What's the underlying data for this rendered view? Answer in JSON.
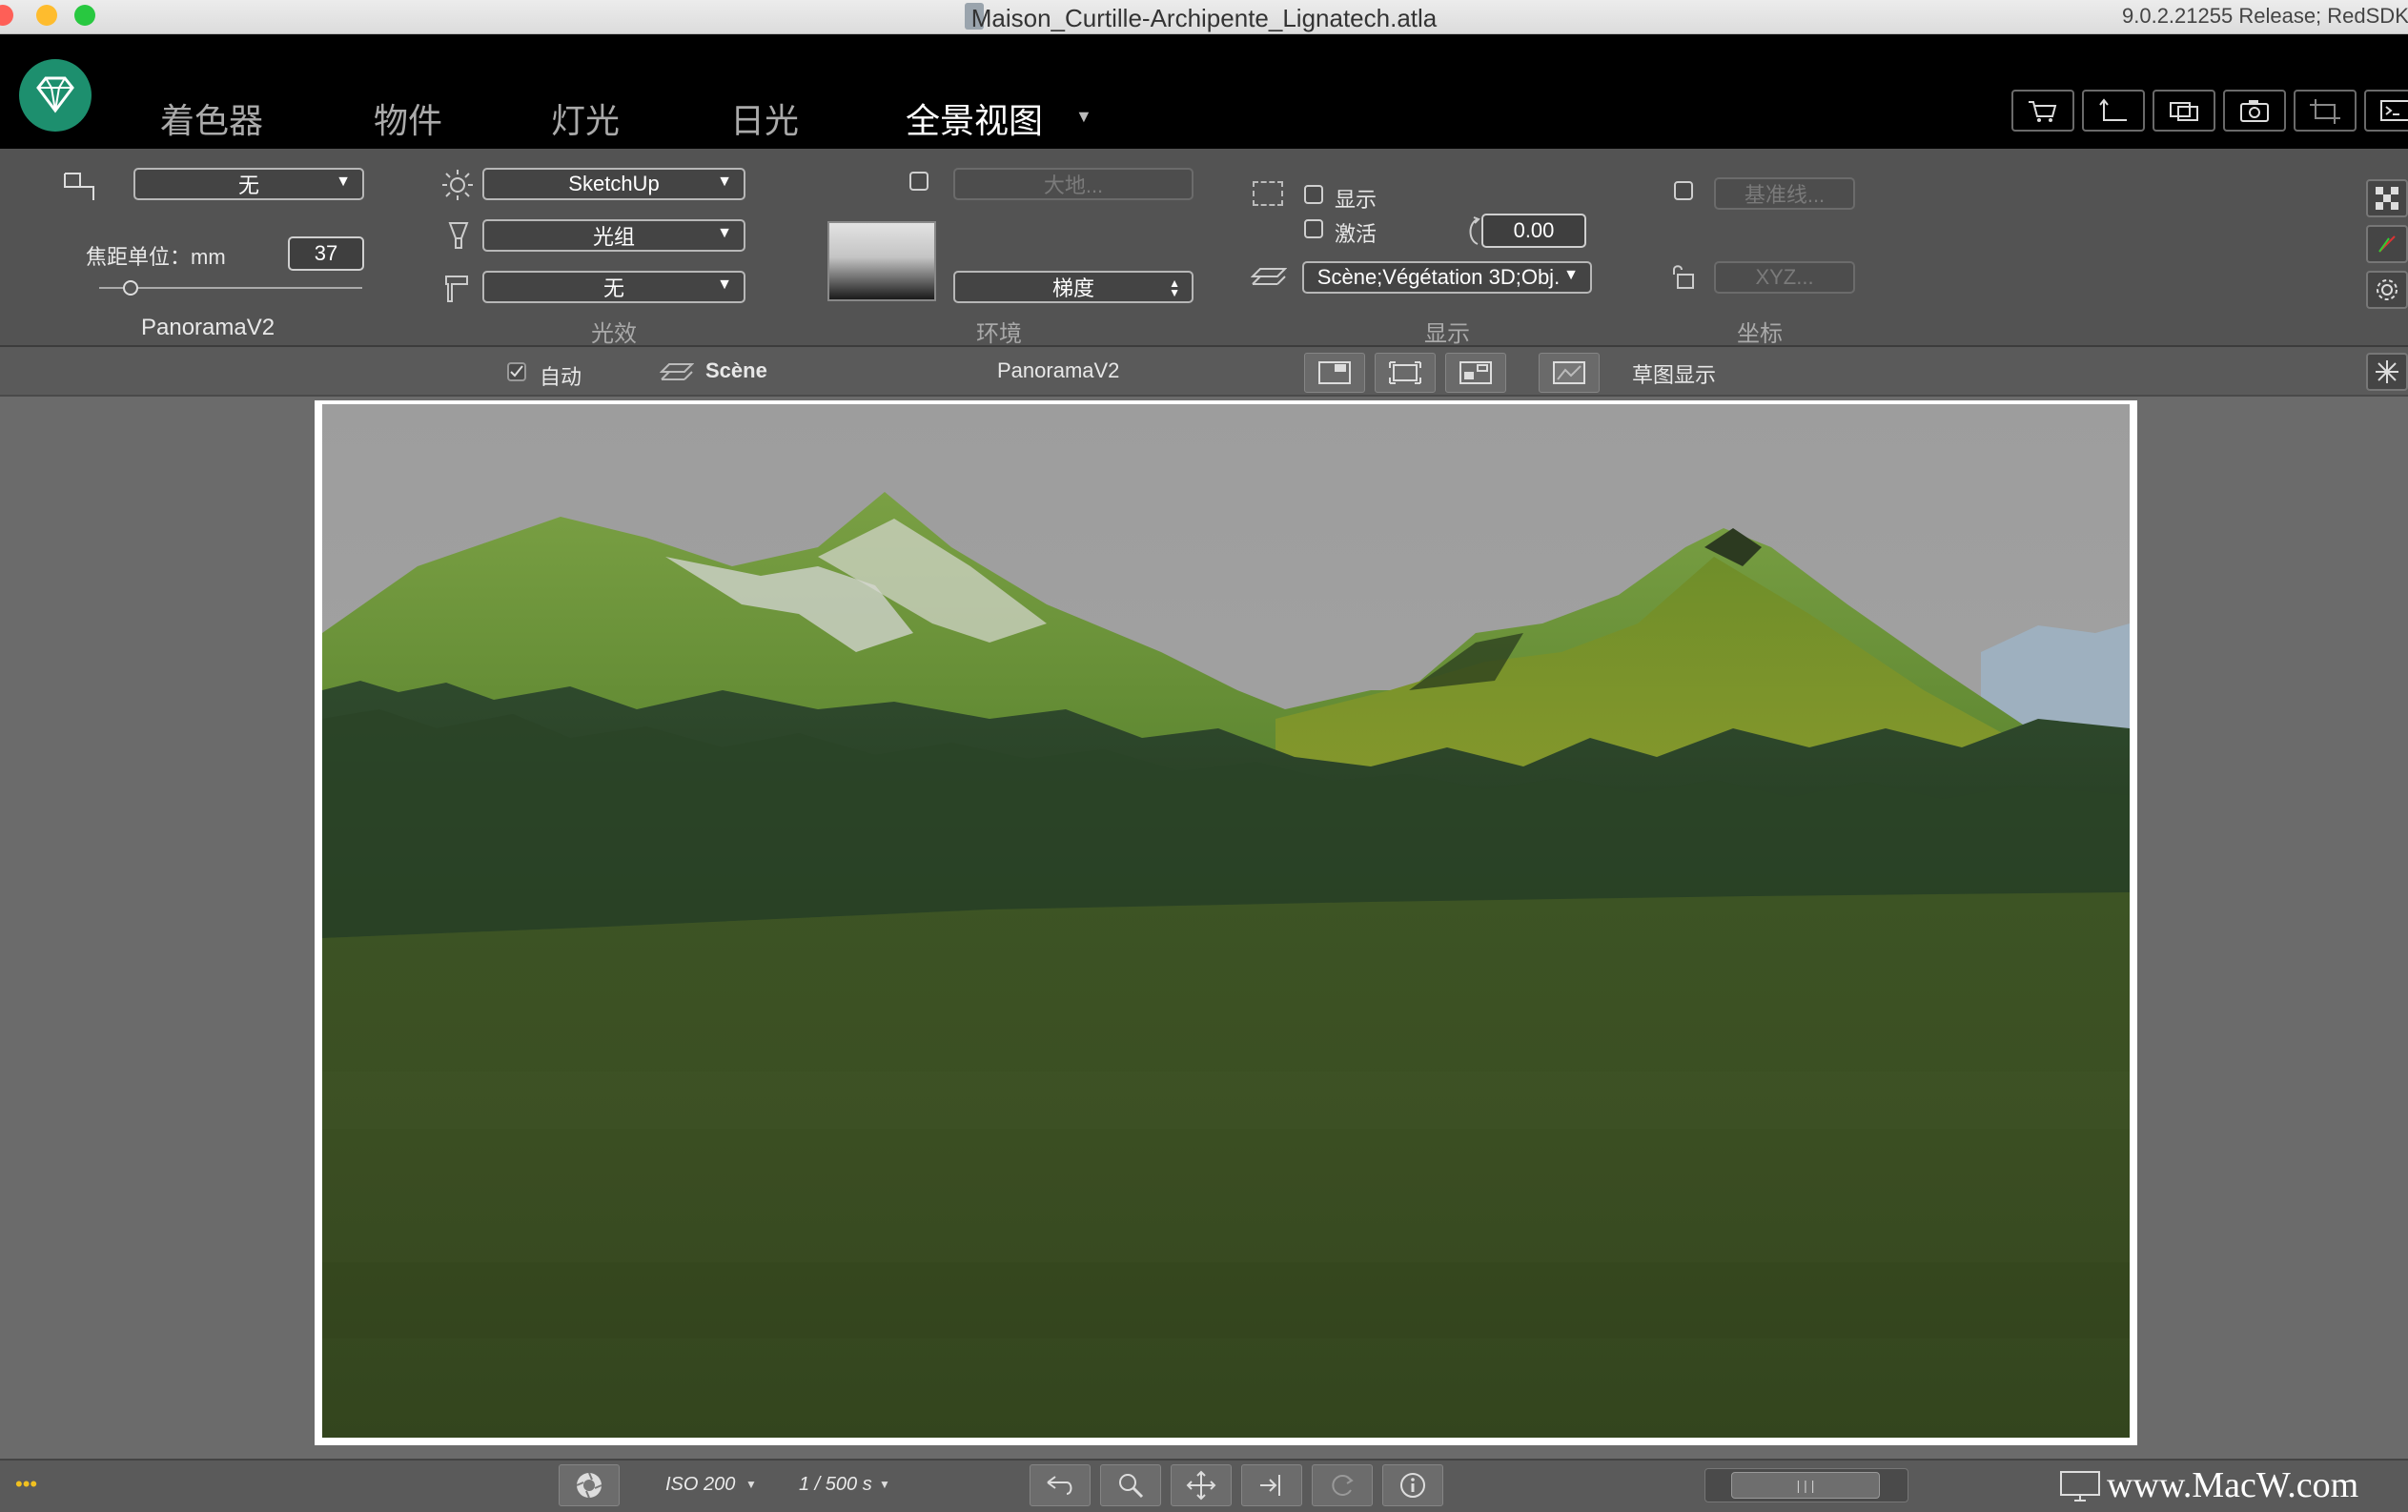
{
  "window": {
    "title": "Maison_Curtille-Archipente_Lignatech.atla",
    "version": "9.0.2.21255 Release; RedSDK"
  },
  "nav": {
    "tabs": [
      {
        "label": "着色器"
      },
      {
        "label": "物件"
      },
      {
        "label": "灯光"
      },
      {
        "label": "日光"
      },
      {
        "label": "全景视图"
      }
    ],
    "active": "全景视图",
    "toolbar_icons": [
      "cart-icon",
      "export-icon",
      "screens-icon",
      "camera-icon",
      "crop-icon",
      "console-icon"
    ]
  },
  "camera": {
    "dropdown": "无",
    "focal_label": "焦距单位：mm",
    "focal_value": "37",
    "focal_slider_fraction": 0.12,
    "name": "PanoramaV2"
  },
  "lighting": {
    "sun_source": "SketchUp",
    "light_group": "光组",
    "effect": "无",
    "section": "光效"
  },
  "environment": {
    "ground_button": "大地...",
    "background_mode": "梯度",
    "section": "环境"
  },
  "display": {
    "show_label": "显示",
    "activate_label": "激活",
    "value": "0.00",
    "layers": "Scène;Végétation 3D;Obj.",
    "section": "显示"
  },
  "coords": {
    "baseline_button": "基准线...",
    "xyz_button": "XYZ...",
    "section": "坐标"
  },
  "viewbar": {
    "auto_label": "自动",
    "scene_label": "Scène",
    "view_name": "PanoramaV2",
    "sketch_label": "草图显示"
  },
  "bottombar": {
    "iso": "ISO 200",
    "shutter": "1 / 500 s",
    "dots": "•••",
    "watermark": "www.MacW.com"
  },
  "colors": {
    "accent_green": "#1d8f6e",
    "panel": "#535353",
    "nav_bg": "#000000"
  }
}
